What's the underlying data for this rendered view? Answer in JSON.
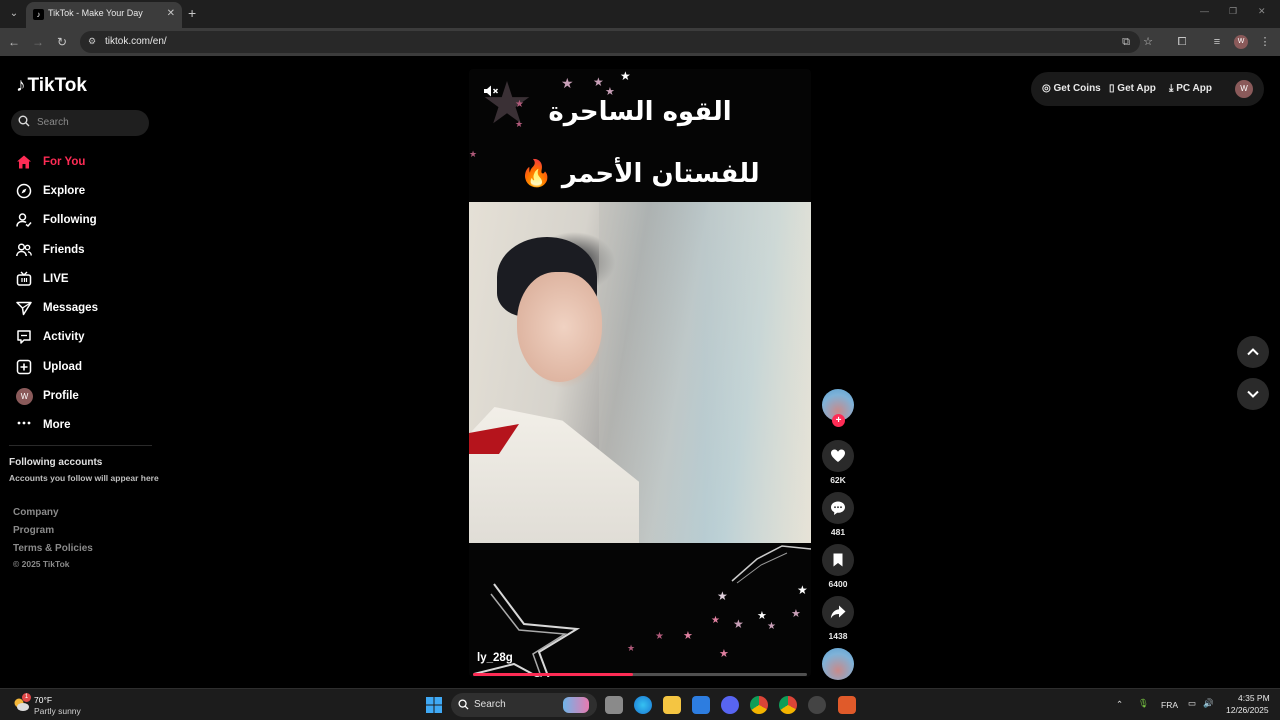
{
  "browser": {
    "tab_title": "TikTok - Make Your Day",
    "url": "tiktok.com/en/",
    "profile_initial": "W"
  },
  "sidebar": {
    "logo_text": "TikTok",
    "search_placeholder": "Search",
    "nav": [
      {
        "label": "For You",
        "icon": "home-icon",
        "active": true
      },
      {
        "label": "Explore",
        "icon": "compass-icon"
      },
      {
        "label": "Following",
        "icon": "following-icon"
      },
      {
        "label": "Friends",
        "icon": "friends-icon"
      },
      {
        "label": "LIVE",
        "icon": "live-icon"
      },
      {
        "label": "Messages",
        "icon": "messages-icon"
      },
      {
        "label": "Activity",
        "icon": "activity-icon"
      },
      {
        "label": "Upload",
        "icon": "upload-icon"
      },
      {
        "label": "Profile",
        "icon": "profile-avatar"
      },
      {
        "label": "More",
        "icon": "more-icon"
      }
    ],
    "profile_initial": "W",
    "following_title": "Following accounts",
    "following_sub": "Accounts you follow will appear here",
    "footer": [
      "Company",
      "Program",
      "Terms & Policies"
    ],
    "copyright": "© 2025 TikTok"
  },
  "top_actions": {
    "get_coins": "Get Coins",
    "get_app": "Get App",
    "pc_app": "PC App",
    "avatar_initial": "W"
  },
  "video": {
    "caption_line1": "القوه الساحرة",
    "caption_line2": "للفستان الأحمر 🔥",
    "creator": "ly_28g",
    "progress": 0.48
  },
  "actions": {
    "likes": "62K",
    "comments": "481",
    "saves": "6400",
    "shares": "1438"
  },
  "taskbar": {
    "weather_temp": "70°F",
    "weather_desc": "Partly sunny",
    "weather_badge": "1",
    "search_label": "Search",
    "language": "FRA",
    "time": "4:35 PM",
    "date": "12/26/2025"
  },
  "colors": {
    "accent": "#fe2c55",
    "background": "#000000"
  }
}
